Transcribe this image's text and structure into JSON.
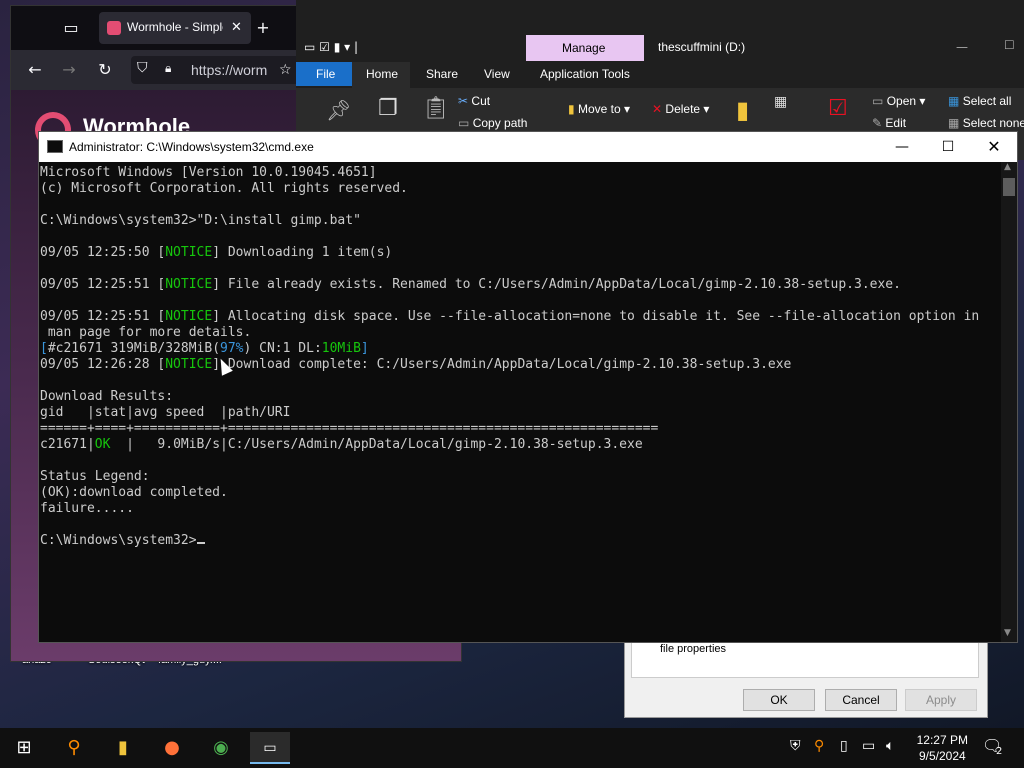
{
  "desktop": {
    "icons": [
      "anazc",
      "SoulseekQt",
      "family_guy...."
    ]
  },
  "browser": {
    "tab_title": "Wormhole - Simple, private file sharing",
    "url": "https://worm",
    "page_heading": "Wormhole"
  },
  "explorer": {
    "manage_label": "Manage",
    "drive_label": "thescuffmini (D:)",
    "tabs": [
      "File",
      "Home",
      "Share",
      "View",
      "Application Tools"
    ],
    "cut": "Cut",
    "copy_path": "Copy path",
    "move_to": "Move to",
    "delete": "Delete",
    "open": "Open",
    "edit": "Edit",
    "select_all": "Select all",
    "select_none": "Select none"
  },
  "dialog": {
    "text": "file properties",
    "ok": "OK",
    "cancel": "Cancel",
    "apply": "Apply"
  },
  "cmd": {
    "title": "Administrator: C:\\Windows\\system32\\cmd.exe",
    "lines": {
      "l1": "Microsoft Windows [Version 10.0.19045.4651]",
      "l2": "(c) Microsoft Corporation. All rights reserved.",
      "l3": "C:\\Windows\\system32>\"D:\\install gimp.bat\"",
      "l4a": "09/05 12:25:50 [",
      "l4b": "NOTICE",
      "l4c": "] Downloading 1 item(s)",
      "l5a": "09/05 12:25:51 [",
      "l5b": "NOTICE",
      "l5c": "] File already exists. Renamed to C:/Users/Admin/AppData/Local/gimp-2.10.38-setup.3.exe.",
      "l6a": "09/05 12:25:51 [",
      "l6b": "NOTICE",
      "l6c": "] Allocating disk space. Use --file-allocation=none to disable it. See --file-allocation option in",
      "l7": " man page for more details.",
      "l8a": "[",
      "l8b": "#c21671 319MiB/328MiB(",
      "l8c": "97%",
      "l8d": ") CN:1 DL:",
      "l8e": "10MiB",
      "l8f": "]",
      "l9a": "09/05 12:26:28 [",
      "l9b": "NOTICE",
      "l9c": "] Download complete: C:/Users/Admin/AppData/Local/gimp-2.10.38-setup.3.exe",
      "l10": "Download Results:",
      "l11": "gid   |stat|avg speed  |path/URI",
      "l12": "======+====+===========+=======================================================",
      "l13a": "c21671|",
      "l13b": "OK",
      "l13c": "  |   9.0MiB/s|C:/Users/Admin/AppData/Local/gimp-2.10.38-setup.3.exe",
      "l14": "Status Legend:",
      "l15": "(OK):download completed.",
      "l16": "failure.....",
      "l17": "C:\\Windows\\system32>"
    }
  },
  "taskbar": {
    "time": "12:27 PM",
    "date": "9/5/2024",
    "notification_count": "2"
  },
  "colors": {
    "notice_green": "#16c60c",
    "progress_blue": "#3a96dd",
    "console_bg": "#0c0c0c"
  }
}
